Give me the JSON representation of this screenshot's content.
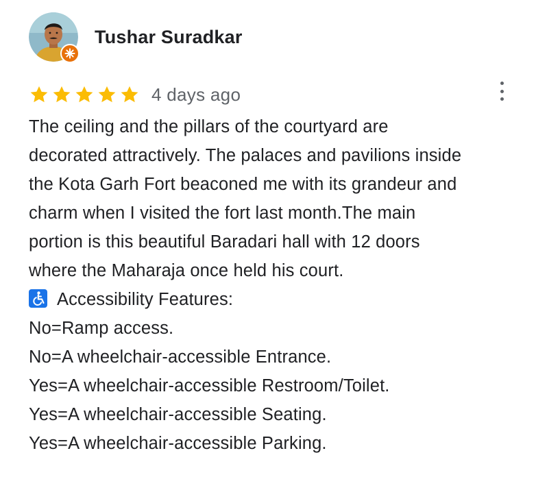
{
  "author": {
    "name": "Tushar Suradkar",
    "avatar_icon": "user-avatar",
    "badge_icon": "local-guide-badge",
    "badge_color": "#e8710a"
  },
  "rating": {
    "stars": 5,
    "max": 5,
    "star_color": "#fbbc04",
    "time_ago": "4 days ago"
  },
  "menu": {
    "icon": "more-vert-icon"
  },
  "review": {
    "lines": [
      "The ceiling and the pillars of the courtyard are",
      "decorated attractively. The palaces and pavilions inside",
      "the Kota Garh Fort beaconed me with its grandeur and",
      "charm when I visited the fort last month.The main",
      "portion is this beautiful Baradari hall with 12 doors",
      "where the Maharaja once held his court."
    ],
    "accessibility_heading": "Accessibility Features:",
    "accessibility_icon": "wheelchair-icon",
    "accessibility_items": [
      "No=Ramp access.",
      "No=A wheelchair-accessible Entrance.",
      "Yes=A wheelchair-accessible Restroom/Toilet.",
      "Yes=A wheelchair-accessible Seating.",
      "Yes=A wheelchair-accessible Parking."
    ]
  }
}
